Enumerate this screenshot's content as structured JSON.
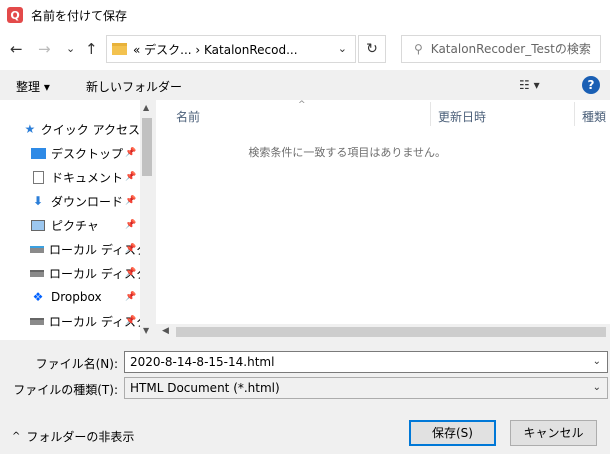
{
  "window": {
    "title": "名前を付けて保存",
    "app_icon": "Q"
  },
  "nav": {
    "back": "←",
    "forward": "→",
    "recent": "⌄",
    "up": "↑",
    "address": {
      "crumbs": "« デスク...  ›  KatalonRecod..."
    },
    "refresh": "↻",
    "search": {
      "placeholder": "KatalonRecoder_Testの検索"
    }
  },
  "toolbar": {
    "organize": "整理 ▾",
    "new_folder": "新しいフォルダー"
  },
  "sidebar": {
    "items": [
      {
        "label": "クイック アクセス",
        "icon": "star-icon"
      },
      {
        "label": "デスクトップ",
        "icon": "desktop-icon",
        "pinned": true
      },
      {
        "label": "ドキュメント",
        "icon": "document-icon",
        "pinned": true
      },
      {
        "label": "ダウンロード",
        "icon": "download-icon",
        "pinned": true
      },
      {
        "label": "ピクチャ",
        "icon": "picture-icon",
        "pinned": true
      },
      {
        "label": "ローカル ディスク",
        "icon": "drive-icon",
        "pinned": true
      },
      {
        "label": "ローカル ディスク",
        "icon": "drive-icon",
        "pinned": true
      },
      {
        "label": "Dropbox",
        "icon": "dropbox-icon",
        "pinned": true
      },
      {
        "label": "ローカル ディスク",
        "icon": "drive-icon",
        "pinned": true
      }
    ]
  },
  "files": {
    "columns": [
      "名前",
      "更新日時",
      "種類"
    ],
    "empty_message": "検索条件に一致する項目はありません。"
  },
  "form": {
    "filename_label": "ファイル名(N):",
    "filename_value": "2020-8-14-8-15-14.html",
    "filetype_label": "ファイルの種類(T):",
    "filetype_value": "HTML Document (*.html)"
  },
  "footer": {
    "hide_folders": "フォルダーの非表示",
    "save": "保存(S)",
    "cancel": "キャンセル"
  },
  "colors": {
    "accent": "#0078d7",
    "link_header": "#4c607a"
  }
}
